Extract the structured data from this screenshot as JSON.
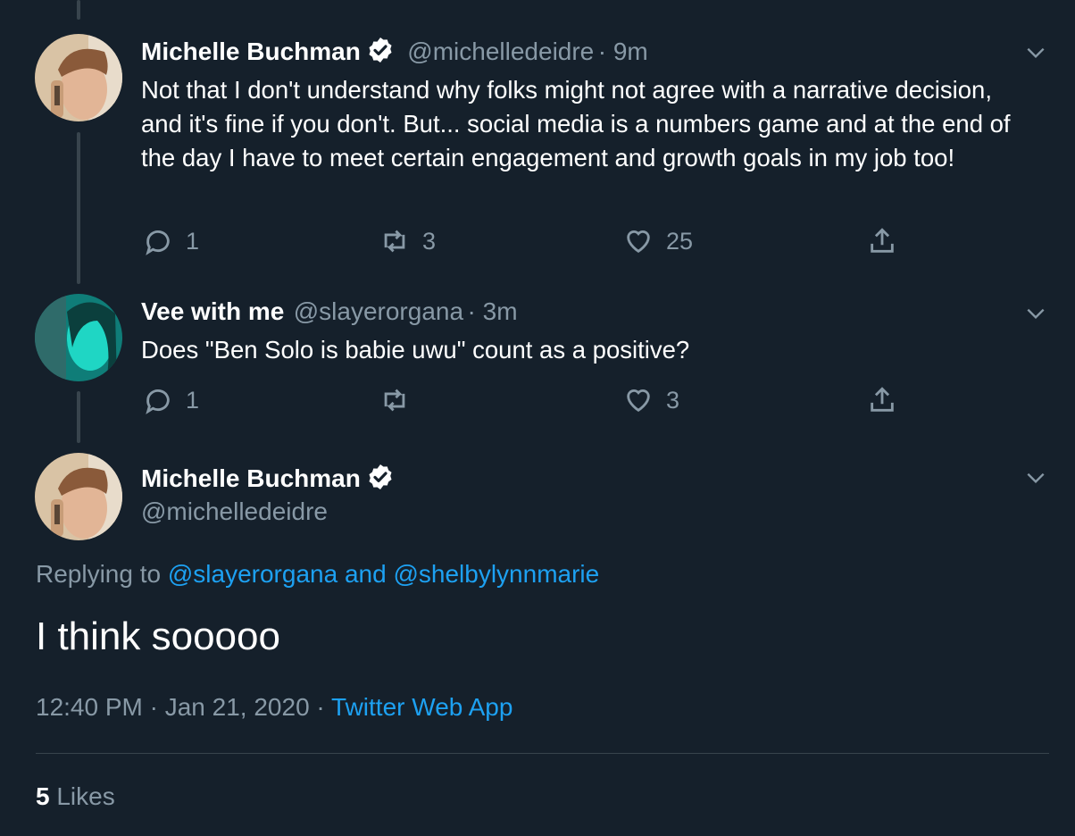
{
  "tweets": [
    {
      "name": "Michelle Buchman",
      "handle": "@michelledeidre",
      "time": "· 9m",
      "text": "Not that I don't understand why folks might not agree with a narrative decision, and it's fine if you don't. But... social media is a numbers game and at the end of the day I have to meet certain engagement and growth goals in my job too!",
      "replies": "1",
      "retweets": "3",
      "likes": "25"
    },
    {
      "name": "Vee with me",
      "handle": "@slayerorgana",
      "time": "· 3m",
      "text": "Does \"Ben Solo is babie uwu\" count as a positive?",
      "replies": "1",
      "retweets": "",
      "likes": "3"
    }
  ],
  "focus": {
    "name": "Michelle Buchman",
    "handle": "@michelledeidre",
    "replying_prefix": "Replying to",
    "reply_user_1": "@slayerorgana",
    "reply_and": "and",
    "reply_user_2": "@shelbylynnmarie",
    "text": "I think sooooo",
    "timestamp": "12:40 PM · Jan 21, 2020 ·",
    "source": "Twitter Web App",
    "likes_count": "5",
    "likes_label": "Likes"
  },
  "icons": {
    "reply": "reply-icon",
    "retweet": "retweet-icon",
    "like": "heart-icon",
    "share": "share-icon",
    "more": "chevron-down-icon",
    "verified": "verified-badge-icon"
  },
  "colors": {
    "background": "#15202b",
    "secondary_text": "#8899a6",
    "accent": "#1da1f2",
    "thread_line": "#38444d"
  }
}
